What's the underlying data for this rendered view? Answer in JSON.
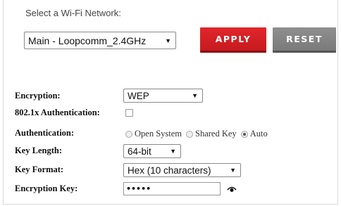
{
  "wifi": {
    "label": "Select a Wi-Fi Network:",
    "selected_network": "Main - Loopcomm_2.4GHz"
  },
  "buttons": {
    "apply": "APPLY",
    "reset": "RESET"
  },
  "form": {
    "encryption_label": "Encryption:",
    "encryption_value": "WEP",
    "auth_8021x_label": "802.1x Authentication:",
    "auth_8021x_checked": false,
    "authentication_label": "Authentication:",
    "authentication_options": [
      "Open System",
      "Shared Key",
      "Auto"
    ],
    "authentication_selected": "Auto",
    "key_length_label": "Key Length:",
    "key_length_value": "64-bit",
    "key_format_label": "Key Format:",
    "key_format_value": "Hex (10 characters)",
    "encryption_key_label": "Encryption Key:",
    "encryption_key_masked": "•••••"
  },
  "colors": {
    "apply": "#d41f24",
    "reset": "#858585"
  },
  "icons": {
    "reveal_password": "eye-icon",
    "dropdown": "caret-down-icon"
  }
}
